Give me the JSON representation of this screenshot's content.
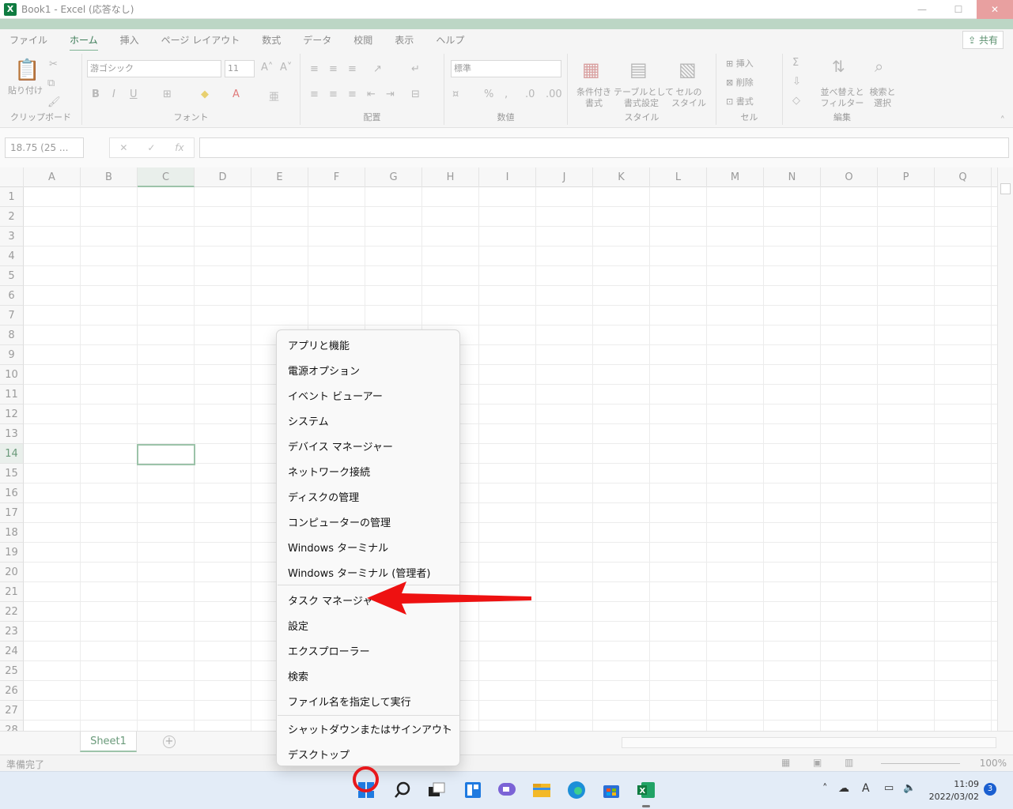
{
  "window": {
    "title": "Book1 - Excel (応答なし)",
    "logo_letter": "X",
    "minimize": "—",
    "maximize": "☐",
    "close": "✕"
  },
  "ribbon": {
    "tabs": [
      "ファイル",
      "ホーム",
      "挿入",
      "ページ レイアウト",
      "数式",
      "データ",
      "校閲",
      "表示",
      "ヘルプ"
    ],
    "share_label": "共有",
    "groups": {
      "clipboard": {
        "label": "クリップボード",
        "paste": "貼り付け"
      },
      "font": {
        "label": "フォント",
        "font_name": "游ゴシック",
        "font_size": "11",
        "bold": "B",
        "italic": "I",
        "underline": "U"
      },
      "alignment": {
        "label": "配置"
      },
      "number": {
        "label": "数値",
        "format": "標準"
      },
      "styles": {
        "label": "スタイル",
        "conditional": "条件付き\n書式",
        "table": "テーブルとして\n書式設定",
        "cell_style": "セルの\nスタイル"
      },
      "cells": {
        "label": "セル",
        "insert": "挿入",
        "delete": "削除",
        "format": "書式"
      },
      "editing": {
        "label": "編集",
        "sort": "並べ替えと\nフィルター",
        "find": "検索と\n選択"
      }
    }
  },
  "formula_bar": {
    "name_box": "18.75 (25 ...",
    "fx": "fx"
  },
  "grid": {
    "columns": [
      "A",
      "B",
      "C",
      "D",
      "E",
      "F",
      "G",
      "H",
      "I",
      "J",
      "K",
      "L",
      "M",
      "N",
      "O",
      "P",
      "Q"
    ],
    "rows": [
      "1",
      "2",
      "3",
      "4",
      "5",
      "6",
      "7",
      "8",
      "9",
      "10",
      "11",
      "12",
      "13",
      "14",
      "15",
      "16",
      "17",
      "18",
      "19",
      "20",
      "21",
      "22",
      "23",
      "24",
      "25",
      "26",
      "27",
      "28"
    ],
    "selected_column": "C",
    "selected_row": "14"
  },
  "sheets": {
    "tabs": [
      "Sheet1"
    ],
    "add_label": "+"
  },
  "status": {
    "ready": "準備完了",
    "zoom": "100%"
  },
  "context_menu": {
    "items": [
      "アプリと機能",
      "電源オプション",
      "イベント ビューアー",
      "システム",
      "デバイス マネージャー",
      "ネットワーク接続",
      "ディスクの管理",
      "コンピューターの管理",
      "Windows ターミナル",
      "Windows ターミナル (管理者)",
      "タスク マネージャー",
      "設定",
      "エクスプローラー",
      "検索",
      "ファイル名を指定して実行",
      "シャットダウンまたはサインアウト",
      "デスクトップ"
    ],
    "submenu_arrow": "›"
  },
  "taskbar": {
    "time": "11:09",
    "date": "2022/03/02",
    "notification_count": "3",
    "ime": "A"
  },
  "colors": {
    "excel_green": "#107c41",
    "annotation_red": "#e8181c",
    "taskbar_bg": "#e3ecf7"
  }
}
